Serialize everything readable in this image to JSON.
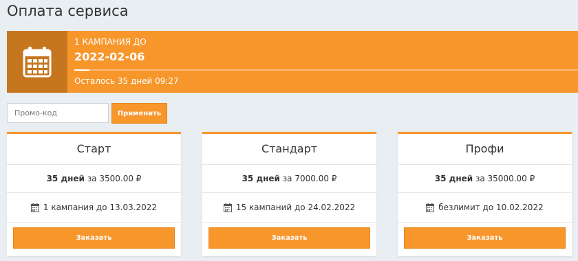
{
  "page": {
    "title": "Оплата сервиса"
  },
  "subscription": {
    "label": "1 КАМПАНИЯ ДО",
    "date": "2022-02-06",
    "remaining": "Осталось 35 дней 09:27",
    "icon": "calendar-icon"
  },
  "promo": {
    "placeholder": "Промо-код",
    "value": "",
    "apply_label": "Применить"
  },
  "plans": [
    {
      "name": "Старт",
      "period": "35 дней",
      "price_text": "за 3500.00 ₽",
      "limit": "1 кампания до 13.03.2022",
      "order_label": "Заказать"
    },
    {
      "name": "Стандарт",
      "period": "35 дней",
      "price_text": "за 7000.00 ₽",
      "limit": "15 кампаний до 24.02.2022",
      "order_label": "Заказать"
    },
    {
      "name": "Профи",
      "period": "35 дней",
      "price_text": "за 35000.00 ₽",
      "limit": "безлимит до 10.02.2022",
      "order_label": "Заказать"
    }
  ],
  "colors": {
    "accent": "#f7962b",
    "accent_dark": "#c5761f",
    "background": "#e9eef3"
  }
}
